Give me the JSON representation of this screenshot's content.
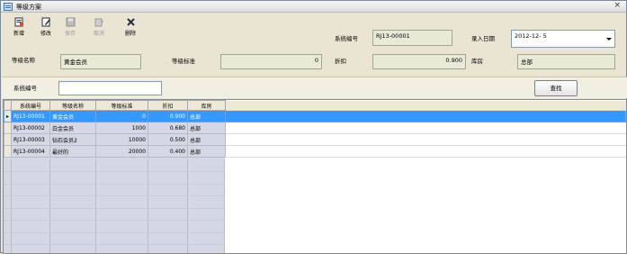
{
  "window": {
    "title": "等级方案",
    "close_glyph": "×"
  },
  "toolbar": {
    "new": "新增",
    "edit": "修改",
    "save": "保存",
    "cancel": "取消",
    "delete": "删除"
  },
  "form": {
    "sysno_label": "系统编号",
    "sysno_value": "RJ13-00001",
    "date_label": "录入日期",
    "date_value": "2012-12- 5",
    "name_label": "等级名称",
    "name_value": "黄金会员",
    "standard_label": "等级标准",
    "standard_value": "0",
    "discount_label": "折扣",
    "discount_value": "0.900",
    "warehouse_label": "库房",
    "warehouse_value": "总部"
  },
  "search": {
    "label": "系统编号",
    "value": "",
    "button": "查找"
  },
  "table": {
    "columns": [
      "系统编号",
      "等级名称",
      "等级标准",
      "折扣",
      "库房"
    ],
    "rows": [
      {
        "sysno": "RJ13-00001",
        "name": "黄金会员",
        "standard": "0",
        "discount": "0.900",
        "warehouse": "总部"
      },
      {
        "sysno": "RJ13-00002",
        "name": "白金会员",
        "standard": "1000",
        "discount": "0.680",
        "warehouse": "总部"
      },
      {
        "sysno": "RJ13-00003",
        "name": "钻石会员2",
        "standard": "10000",
        "discount": "0.500",
        "warehouse": "总部"
      },
      {
        "sysno": "RJ13-00004",
        "name": "最好的",
        "standard": "20000",
        "discount": "0.400",
        "warehouse": "总部"
      }
    ],
    "selected_row": 0
  }
}
